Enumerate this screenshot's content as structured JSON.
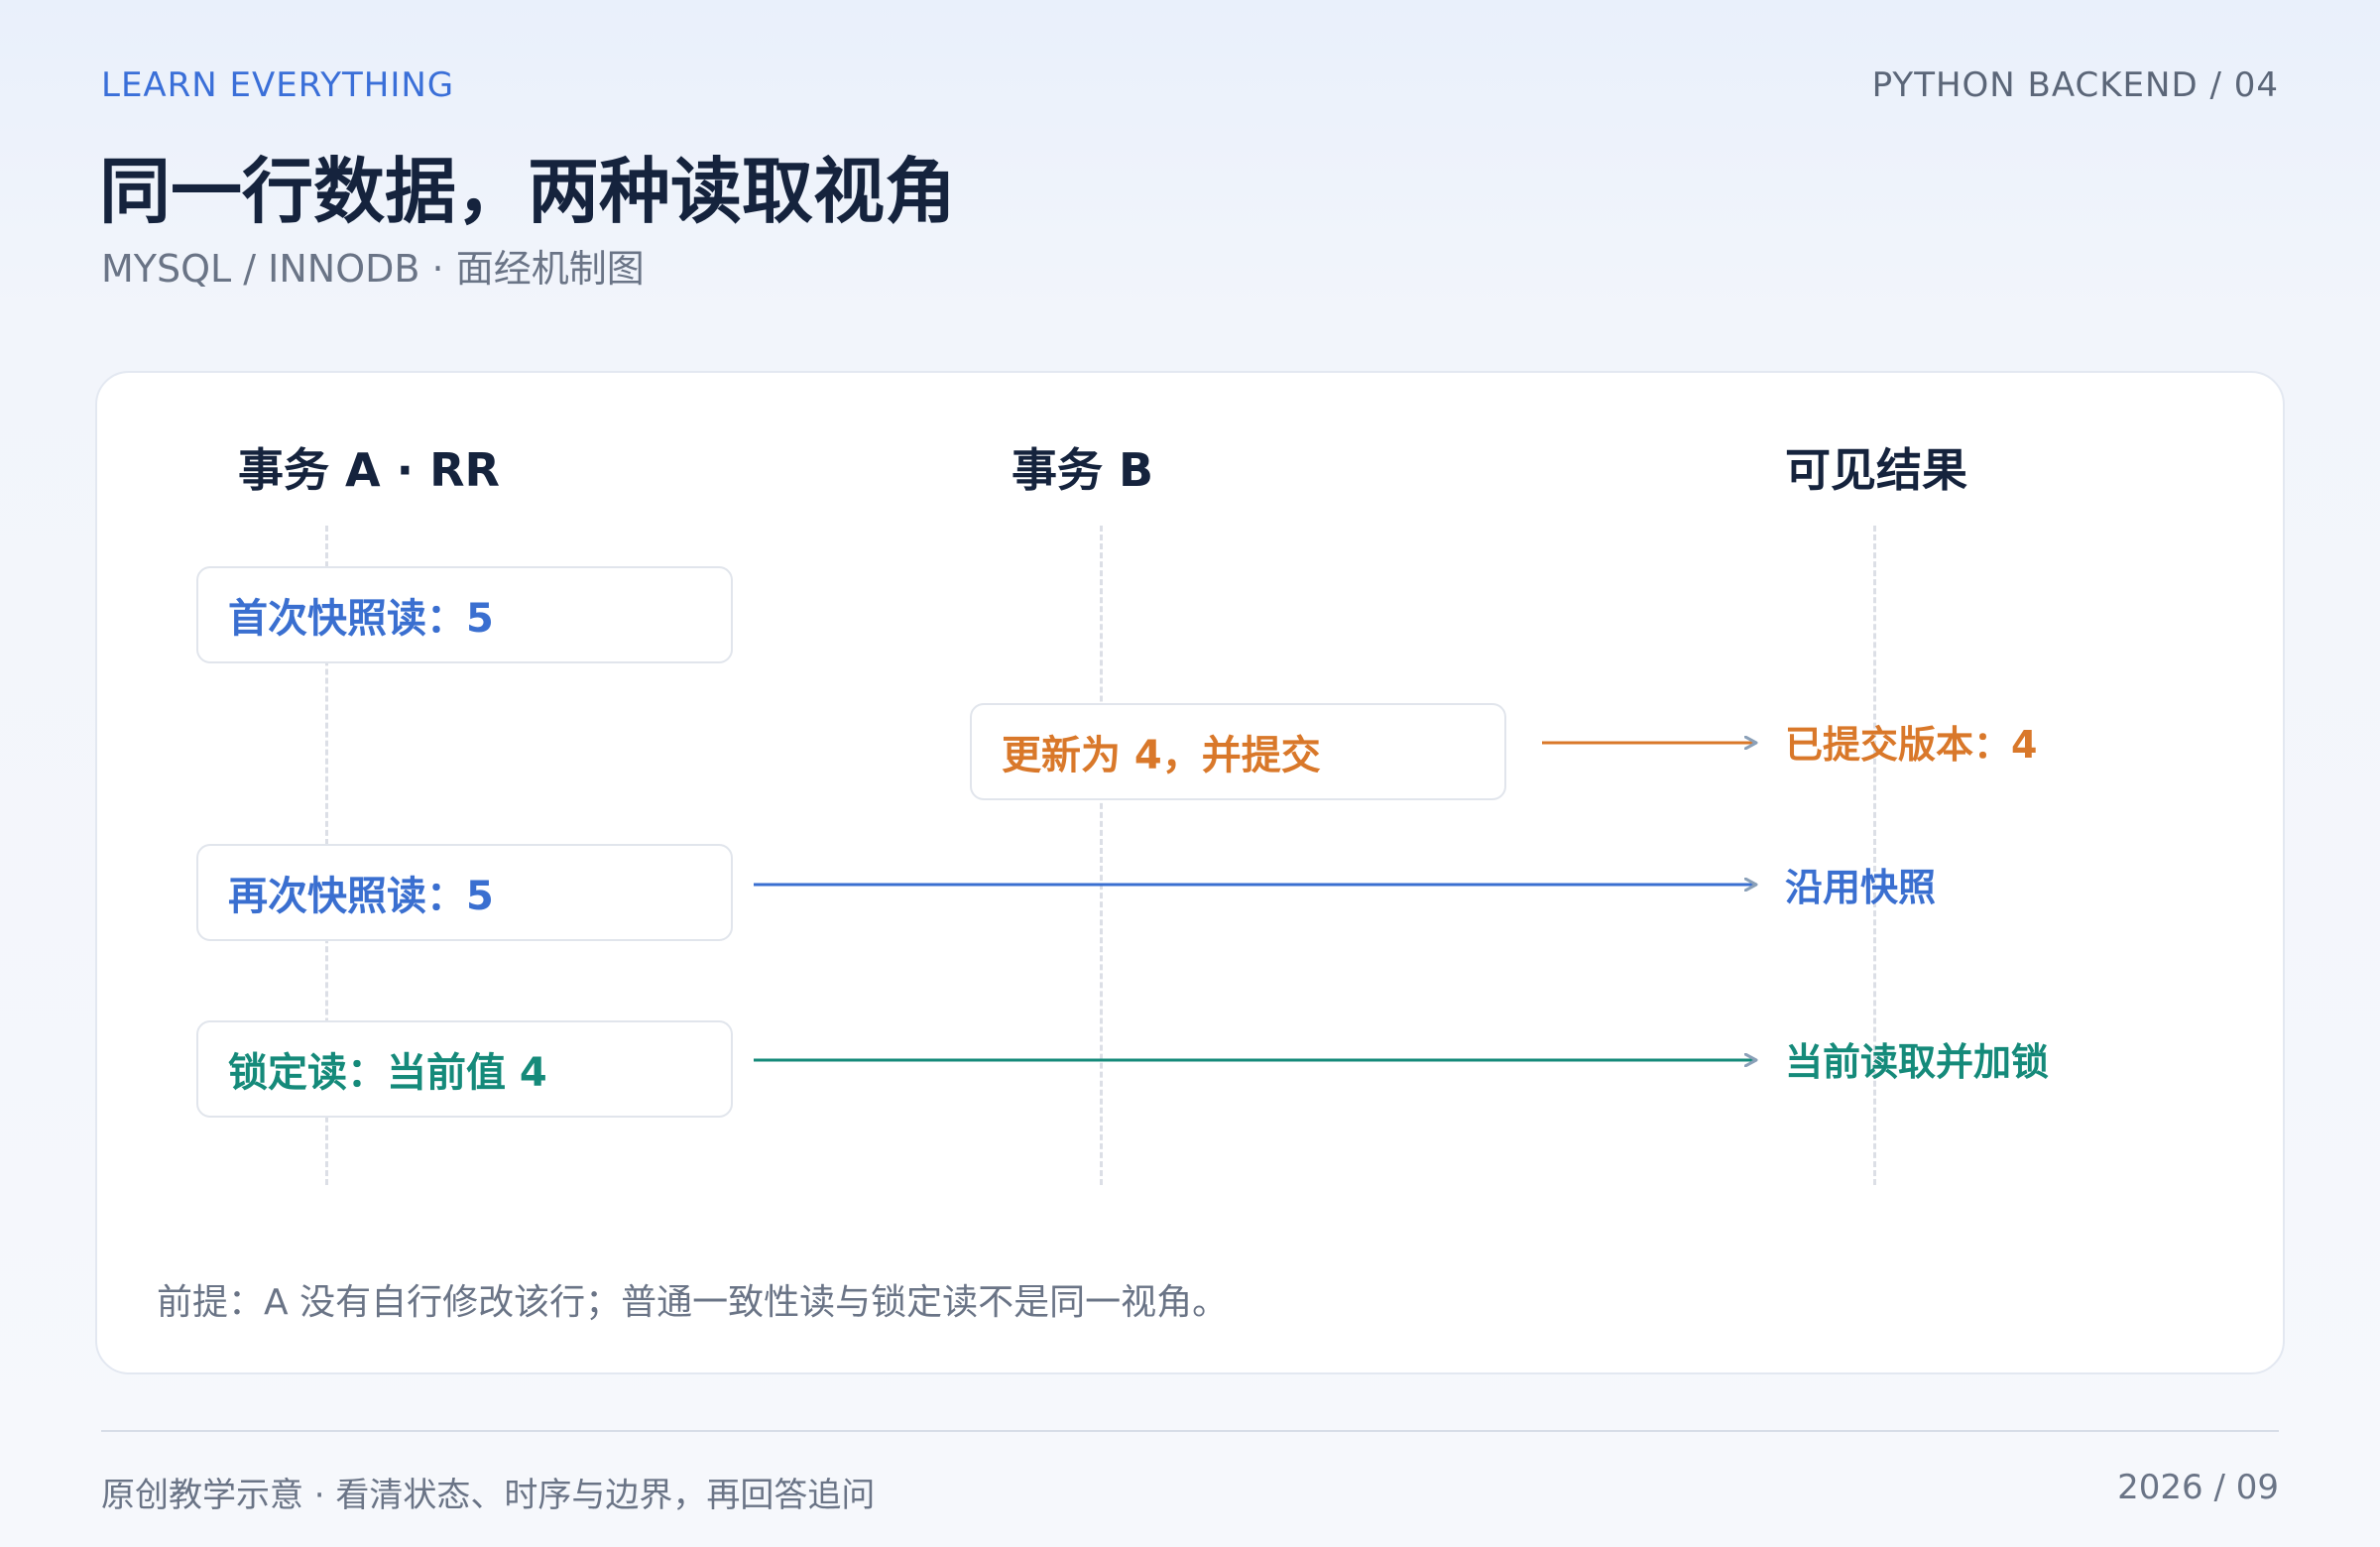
{
  "header": {
    "eyebrow": "LEARN EVERYTHING",
    "series": "PYTHON BACKEND / 04",
    "title": "同一行数据，两种读取视角",
    "subtitle": "MYSQL / INNODB · 面经机制图"
  },
  "diagram": {
    "columns": [
      "事务 A · RR",
      "事务 B",
      "可见结果"
    ],
    "steps": {
      "first_read": "首次快照读：5",
      "update_commit": "更新为 4，并提交",
      "second_read": "再次快照读：5",
      "locking_read": "锁定读：当前值 4"
    },
    "results": {
      "committed_version": "已提交版本：4",
      "keep_snapshot": "沿用快照",
      "current_read_lock": "当前读取并加锁"
    },
    "note": "前提：A 没有自行修改该行；普通一致性读与锁定读不是同一视角。",
    "colors": {
      "blue": "#3a6fd0",
      "orange": "#d9782a",
      "teal": "#158a7a",
      "arrowhead": "#8aa0b8"
    }
  },
  "footer": {
    "left": "原创教学示意 · 看清状态、时序与边界，再回答追问",
    "right": "2026 / 09"
  }
}
